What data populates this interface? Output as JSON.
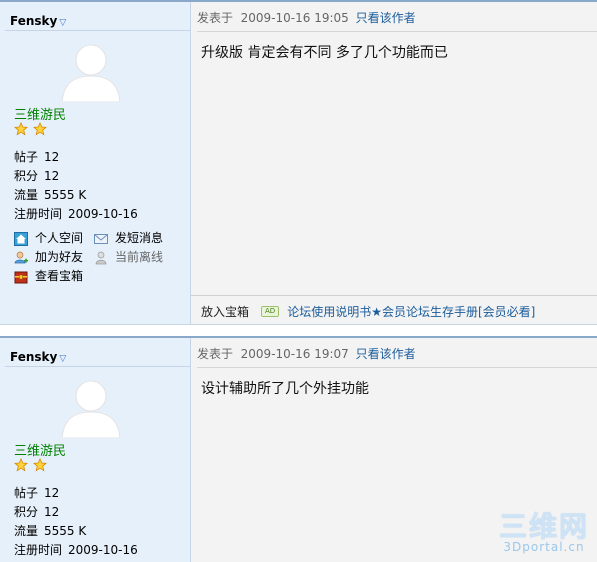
{
  "posts": [
    {
      "author": {
        "username": "Fensky",
        "group": "三维游民",
        "stats": [
          {
            "label": "帖子",
            "value": "12"
          },
          {
            "label": "积分",
            "value": "12"
          },
          {
            "label": "流量",
            "value": "5555 K"
          },
          {
            "label": "注册时间",
            "value": "2009-10-16"
          }
        ],
        "links": [
          {
            "label": "个人空间",
            "icon": "home-icon"
          },
          {
            "label": "发短消息",
            "icon": "mail-icon"
          },
          {
            "label": "加为好友",
            "icon": "add-friend-icon"
          },
          {
            "label": "当前离线",
            "icon": "offline-user-icon"
          },
          {
            "label": "查看宝箱",
            "icon": "treasure-chest-icon"
          }
        ]
      },
      "meta": {
        "posted_label": "发表于",
        "datetime": "2009-10-16 19:05",
        "only_author": "只看该作者"
      },
      "message": "升级版 肯定会有不同 多了几个功能而已",
      "footer": {
        "treasure_label": "放入宝箱",
        "ad_badge": "AD",
        "ad_link": "论坛使用说明书★会员论坛生存手册[会员必看]"
      }
    },
    {
      "author": {
        "username": "Fensky",
        "group": "三维游民",
        "stats": [
          {
            "label": "帖子",
            "value": "12"
          },
          {
            "label": "积分",
            "value": "12"
          },
          {
            "label": "流量",
            "value": "5555 K"
          },
          {
            "label": "注册时间",
            "value": "2009-10-16"
          }
        ]
      },
      "meta": {
        "posted_label": "发表于",
        "datetime": "2009-10-16 19:07",
        "only_author": "只看该作者"
      },
      "message": "设计辅助所了几个外挂功能"
    }
  ],
  "watermark": {
    "title": "三维网",
    "domain": "3Dportal.cn"
  },
  "colors": {
    "link": "#1a5c9a",
    "group": "#008000",
    "author_bg": "#e6f0fa",
    "content_bg": "#f3f3f3",
    "border": "#8aa8c8"
  }
}
